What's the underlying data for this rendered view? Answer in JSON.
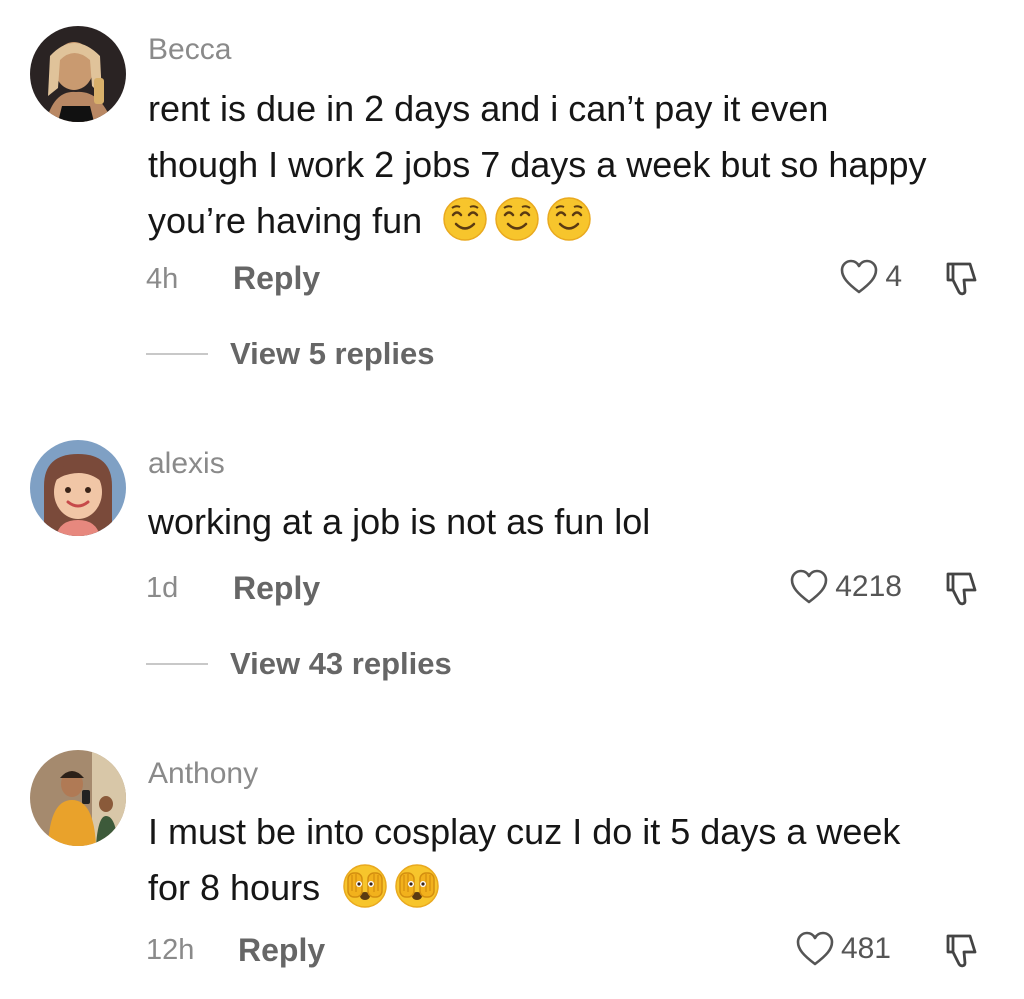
{
  "comments": [
    {
      "username": "Becca",
      "text": "rent is due in 2 days and i can’t pay it even though I work 2 jobs 7 days a week but so happy you’re having fun",
      "emojis": [
        "smiling-face-icon",
        "smiling-face-icon",
        "smiling-face-icon"
      ],
      "time": "4h",
      "reply_label": "Reply",
      "likes": "4",
      "view_replies": "View 5 replies"
    },
    {
      "username": "alexis",
      "text": "working at a job is not as fun lol",
      "emojis": [],
      "time": "1d",
      "reply_label": "Reply",
      "likes": "4218",
      "view_replies": "View 43 replies"
    },
    {
      "username": "Anthony",
      "text": "I must be into cosplay cuz I do it 5 days a week for 8 hours",
      "emojis": [
        "face-with-peeking-eye-icon",
        "face-with-peeking-eye-icon"
      ],
      "time": "12h",
      "reply_label": "Reply",
      "likes": "481"
    }
  ],
  "colors": {
    "background": "#ffffff",
    "primary_text": "#161616",
    "secondary_text": "#8a8a8a",
    "emoji_yellow": "#f7c52c"
  }
}
